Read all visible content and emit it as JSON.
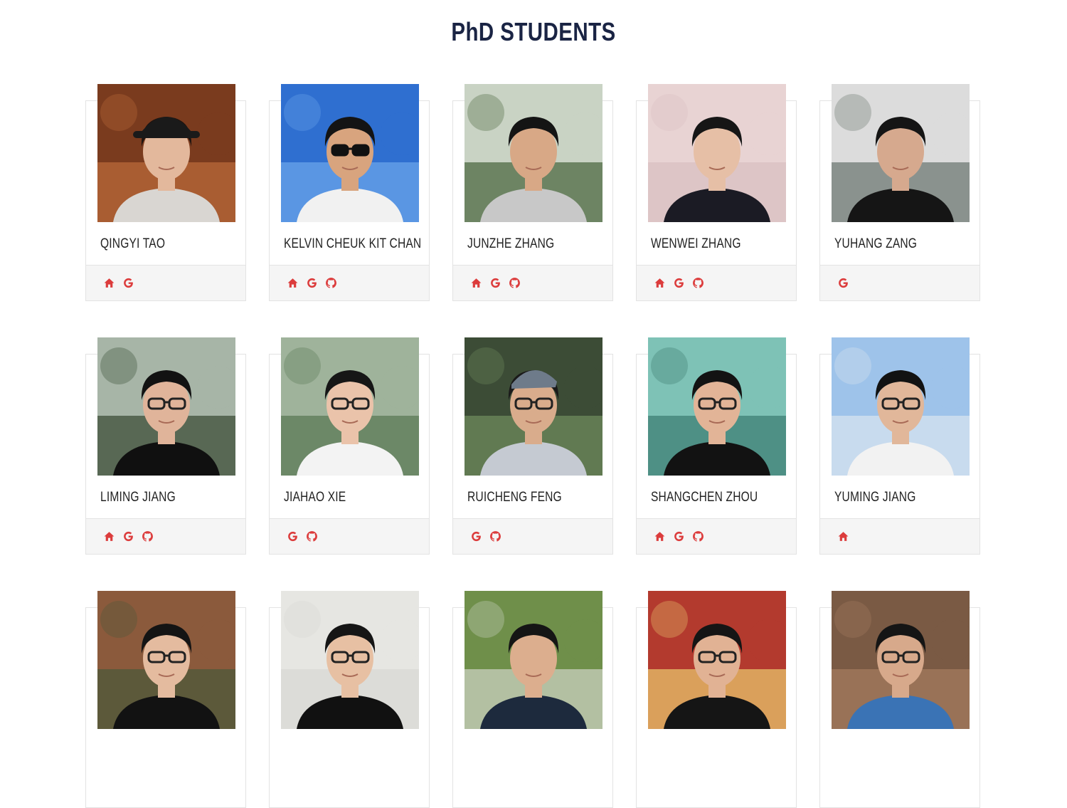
{
  "page": {
    "heading": "PhD STUDENTS"
  },
  "accent_color": "#dc3c3c",
  "students": [
    {
      "name": "QINGYI TAO",
      "links": [
        "home-icon",
        "google-scholar-icon"
      ],
      "photo": {
        "bg": "#7a3b1e",
        "bg2": "#b96a3a",
        "skin": "#e3b89c",
        "hair": "#1e1410",
        "shirt": "#d9d6d2",
        "glasses": false,
        "hat": true
      }
    },
    {
      "name": "KELVIN CHEUK KIT CHAN",
      "links": [
        "home-icon",
        "google-scholar-icon",
        "github-icon"
      ],
      "photo": {
        "bg": "#2f6fd0",
        "bg2": "#6aa3ea",
        "skin": "#d8a47e",
        "hair": "#141414",
        "shirt": "#f1f1f1",
        "glasses": true,
        "sunglasses": true
      }
    },
    {
      "name": "JUNZHE ZHANG",
      "links": [
        "home-icon",
        "google-scholar-icon",
        "github-icon"
      ],
      "photo": {
        "bg": "#c9d3c4",
        "bg2": "#4d6a43",
        "skin": "#d8a886",
        "hair": "#141414",
        "shirt": "#c8c8c8",
        "glasses": false
      }
    },
    {
      "name": "WENWEI ZHANG",
      "links": [
        "home-icon",
        "google-scholar-icon",
        "github-icon"
      ],
      "photo": {
        "bg": "#e8d3d3",
        "bg2": "#d9c0c2",
        "skin": "#e6bfa6",
        "hair": "#161616",
        "shirt": "#1b1b24",
        "glasses": false
      }
    },
    {
      "name": "YUHANG ZANG",
      "links": [
        "google-scholar-icon"
      ],
      "photo": {
        "bg": "#dcdcdc",
        "bg2": "#6f7a74",
        "skin": "#d6a98e",
        "hair": "#151515",
        "shirt": "#151515",
        "glasses": false
      }
    },
    {
      "name": "LIMING JIANG",
      "links": [
        "home-icon",
        "google-scholar-icon",
        "github-icon"
      ],
      "photo": {
        "bg": "#a7b5a7",
        "bg2": "#3d4f38",
        "skin": "#e0b49a",
        "hair": "#121212",
        "shirt": "#101010",
        "glasses": true
      }
    },
    {
      "name": "JIAHAO XIE",
      "links": [
        "google-scholar-icon",
        "github-icon"
      ],
      "photo": {
        "bg": "#9fb39b",
        "bg2": "#5b7a55",
        "skin": "#eac3aa",
        "hair": "#161616",
        "shirt": "#f3f3f3",
        "glasses": true
      }
    },
    {
      "name": "RUICHENG FENG",
      "links": [
        "google-scholar-icon",
        "github-icon"
      ],
      "photo": {
        "bg": "#3c4c36",
        "bg2": "#6e8a5c",
        "skin": "#d9ac8c",
        "hair": "#1a1a1a",
        "shirt": "#c5cad2",
        "glasses": true,
        "cap": true
      }
    },
    {
      "name": "SHANGCHEN ZHOU",
      "links": [
        "home-icon",
        "google-scholar-icon",
        "github-icon"
      ],
      "photo": {
        "bg": "#7ec2b6",
        "bg2": "#3f7f74",
        "skin": "#e2b497",
        "hair": "#131313",
        "shirt": "#121212",
        "glasses": true
      }
    },
    {
      "name": "YUMING JIANG",
      "links": [
        "home-icon"
      ],
      "photo": {
        "bg": "#9ec3ea",
        "bg2": "#d6e3ef",
        "skin": "#e1b79a",
        "hair": "#121212",
        "shirt": "#f2f2f2",
        "glasses": true
      }
    },
    {
      "name": "",
      "links": [],
      "photo": {
        "bg": "#8b5a3c",
        "bg2": "#4c5a3a",
        "skin": "#e4bb9f",
        "hair": "#141414",
        "shirt": "#121212",
        "glasses": true
      }
    },
    {
      "name": "",
      "links": [],
      "photo": {
        "bg": "#e6e6e2",
        "bg2": "#d8d8d4",
        "skin": "#e7c0a3",
        "hair": "#151515",
        "shirt": "#111111",
        "glasses": true
      }
    },
    {
      "name": "",
      "links": [],
      "photo": {
        "bg": "#6f8f4a",
        "bg2": "#c9d0c0",
        "skin": "#dcae8e",
        "hair": "#151515",
        "shirt": "#1d2a3d",
        "glasses": false
      }
    },
    {
      "name": "",
      "links": [],
      "photo": {
        "bg": "#b33a2e",
        "bg2": "#e7c36b",
        "skin": "#e1b294",
        "hair": "#151515",
        "shirt": "#151515",
        "glasses": true
      }
    },
    {
      "name": "",
      "links": [],
      "photo": {
        "bg": "#7a5a44",
        "bg2": "#a47b5e",
        "skin": "#d7a98b",
        "hair": "#151515",
        "shirt": "#3a73b5",
        "glasses": true
      }
    }
  ]
}
